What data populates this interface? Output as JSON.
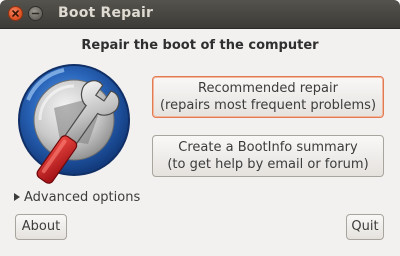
{
  "window": {
    "title": "Boot Repair"
  },
  "main": {
    "heading": "Repair the boot of the computer",
    "recommended": {
      "line1": "Recommended repair",
      "line2": "(repairs most frequent problems)"
    },
    "bootinfo": {
      "line1": "Create a BootInfo summary",
      "line2": "(to get help by email or forum)"
    },
    "advanced_label": "Advanced options"
  },
  "footer": {
    "about_label": "About",
    "quit_label": "Quit"
  },
  "icons": {
    "logo": "disk-wrench-icon",
    "close": "close-icon",
    "minimize": "minimize-icon",
    "expander": "triangle-right-icon"
  },
  "colors": {
    "titlebar": "#3c3b37",
    "close_button": "#e05327",
    "recommended_border": "#e27a52",
    "window_bg": "#f2f1f0",
    "wrench_red": "#c8161d"
  }
}
